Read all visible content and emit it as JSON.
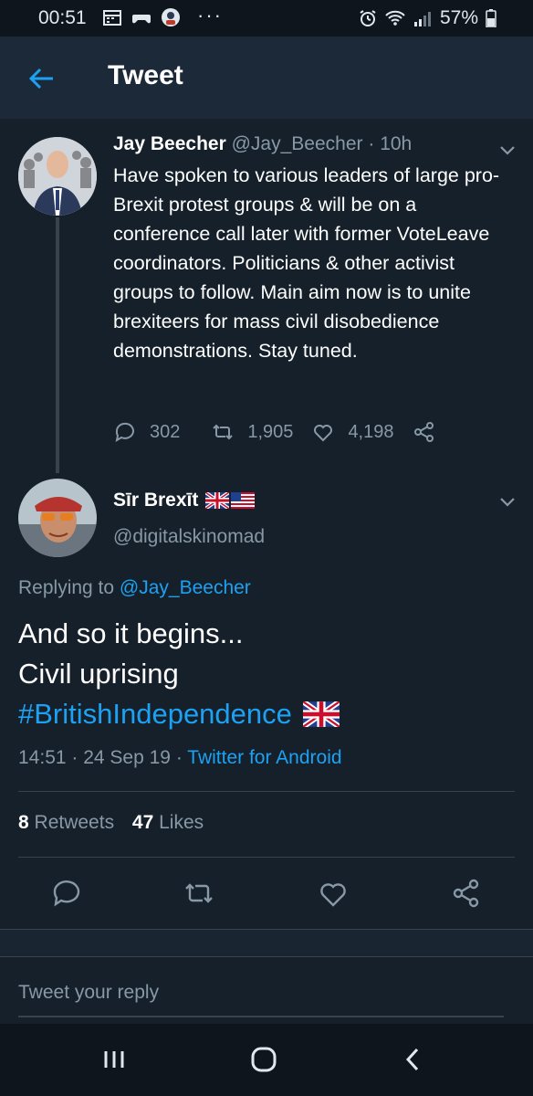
{
  "status_bar": {
    "time": "00:51",
    "battery": "57%",
    "dots": "···"
  },
  "header": {
    "title": "Tweet"
  },
  "tweet1": {
    "name": "Jay Beecher",
    "handle": "@Jay_Beecher",
    "separator": " · ",
    "time": "10h",
    "text": "Have spoken to various leaders of large pro-Brexit protest groups & will be on a conference call later with former VoteLeave coordinators. Politicians & other activist groups to follow. Main aim now is to unite brexiteers for mass civil disobedience demonstrations. Stay tuned.",
    "replies": "302",
    "retweets": "1,905",
    "likes": "4,198"
  },
  "tweet2": {
    "name": "Sīr Brexīt",
    "handle": "@digitalskinomad",
    "replying_prefix": "Replying to ",
    "replying_to": "@Jay_Beecher",
    "line1": "And so it begins...",
    "line2": "Civil uprising",
    "hashtag": "#BritishIndependence",
    "time": "14:51",
    "date": "24 Sep 19",
    "client": "Twitter for Android",
    "meta_sep": " · ",
    "retweets_count": "8",
    "retweets_label": "Retweets",
    "likes_count": "47",
    "likes_label": "Likes"
  },
  "reply": {
    "placeholder": "Tweet your reply"
  },
  "colors": {
    "background": "#15202b",
    "accent": "#1da1f2",
    "muted": "#8899a6"
  }
}
